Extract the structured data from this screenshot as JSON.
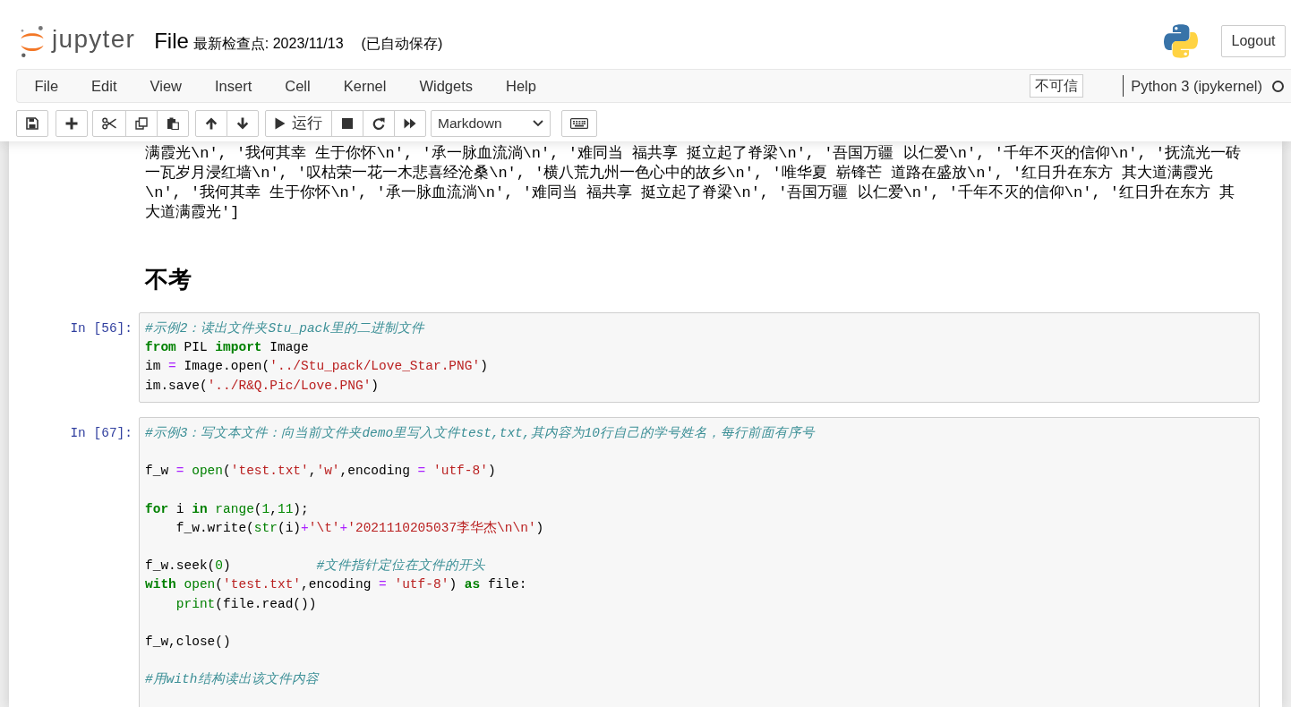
{
  "header": {
    "logo_text": "jupyter",
    "notebook_name": "File",
    "checkpoint": "最新检查点: 2023/11/13",
    "autosave": "(已自动保存)",
    "logout": "Logout"
  },
  "menubar": {
    "items": [
      "File",
      "Edit",
      "View",
      "Insert",
      "Cell",
      "Kernel",
      "Widgets",
      "Help"
    ],
    "trust": "不可信",
    "kernel_name": "Python 3 (ipykernel)",
    "kernel_busy": false
  },
  "toolbar": {
    "run_label": "运行",
    "cell_type": "Markdown"
  },
  "notebook": {
    "output_lines": [
      "满霞光\\n', '我何其幸 生于你怀\\n', '承一脉血流淌\\n', '难同当 福共享 挺立起了脊梁\\n', '吾国万疆 以仁爱\\n', '千年不灭的信仰\\n', '抚流光一砖",
      "一瓦岁月浸红墙\\n', '叹枯荣一花一木悲喜经沧桑\\n', '横八荒九州一色心中的故乡\\n', '唯华夏 崭锋芒 道路在盛放\\n', '红日升在东方 其大道满霞光",
      "\\n', '我何其幸 生于你怀\\n', '承一脉血流淌\\n', '难同当 福共享 挺立起了脊梁\\n', '吾国万疆 以仁爱\\n', '千年不灭的信仰\\n', '红日升在东方 其",
      "大道满霞光']"
    ],
    "heading": "不考",
    "cells": [
      {
        "prompt": "In [56]:",
        "lines": [
          {
            "kind": "code",
            "tokens": [
              {
                "kind": "comment",
                "text": "#示例2：读出文件夹Stu_pack里的二进制文件"
              }
            ]
          },
          {
            "kind": "code",
            "tokens": [
              {
                "kind": "keyword",
                "text": "from"
              },
              " PIL ",
              {
                "kind": "keyword",
                "text": "import"
              },
              " Image"
            ]
          },
          {
            "kind": "code",
            "tokens": [
              "im ",
              {
                "kind": "operator",
                "text": "="
              },
              " Image.open(",
              {
                "kind": "string",
                "text": "'../Stu_pack/Love_Star.PNG'"
              },
              ")"
            ]
          },
          {
            "kind": "code",
            "tokens": [
              "im.save(",
              {
                "kind": "string",
                "text": "'../R&Q.Pic/Love.PNG'"
              },
              ")"
            ]
          }
        ]
      },
      {
        "prompt": "In [67]:",
        "lines": [
          {
            "kind": "code",
            "tokens": [
              {
                "kind": "comment",
                "text": "#示例3：写文本文件：向当前文件夹demo里写入文件test,txt,其内容为10行自己的学号姓名，每行前面有序号"
              }
            ]
          },
          {
            "kind": "blank"
          },
          {
            "kind": "code",
            "tokens": [
              "f_w ",
              {
                "kind": "operator",
                "text": "= "
              },
              {
                "kind": "builtin",
                "text": "open"
              },
              "(",
              {
                "kind": "string",
                "text": "'test.txt'"
              },
              ",",
              {
                "kind": "string",
                "text": "'w'"
              },
              ",encoding ",
              {
                "kind": "operator",
                "text": "= "
              },
              {
                "kind": "string",
                "text": "'utf-8'"
              },
              ")"
            ]
          },
          {
            "kind": "blank"
          },
          {
            "kind": "code",
            "tokens": [
              {
                "kind": "keyword",
                "text": "for"
              },
              " i ",
              {
                "kind": "keyword",
                "text": "in "
              },
              {
                "kind": "builtin",
                "text": "range"
              },
              "(",
              {
                "kind": "number",
                "text": "1"
              },
              ",",
              {
                "kind": "number",
                "text": "11"
              },
              ");"
            ]
          },
          {
            "kind": "code",
            "tokens": [
              "    f_w.write(",
              {
                "kind": "builtin",
                "text": "str"
              },
              "(i)",
              {
                "kind": "operator",
                "text": "+"
              },
              {
                "kind": "string",
                "text": "'\\t'"
              },
              {
                "kind": "operator",
                "text": "+"
              },
              {
                "kind": "string",
                "text": "'2021110205037李华杰\\n\\n'"
              },
              ")"
            ]
          },
          {
            "kind": "blank"
          },
          {
            "kind": "code",
            "tokens": [
              "f_w.seek(",
              {
                "kind": "number",
                "text": "0"
              },
              ")           ",
              {
                "kind": "comment",
                "text": "#文件指针定位在文件的开头"
              }
            ]
          },
          {
            "kind": "code",
            "tokens": [
              {
                "kind": "keyword",
                "text": "with "
              },
              {
                "kind": "builtin",
                "text": "open"
              },
              "(",
              {
                "kind": "string",
                "text": "'test.txt'"
              },
              ",encoding ",
              {
                "kind": "operator",
                "text": "= "
              },
              {
                "kind": "string",
                "text": "'utf-8'"
              },
              ") ",
              {
                "kind": "keyword",
                "text": "as"
              },
              " file:"
            ]
          },
          {
            "kind": "code",
            "tokens": [
              {
                "kind": "builtin",
                "text": "    print"
              },
              "(file.read())"
            ]
          },
          {
            "kind": "blank"
          },
          {
            "kind": "code",
            "tokens": [
              "f_w,close()"
            ]
          },
          {
            "kind": "blank"
          },
          {
            "kind": "code",
            "tokens": [
              {
                "kind": "comment",
                "text": "#用with结构读出该文件内容"
              }
            ]
          }
        ]
      }
    ]
  }
}
